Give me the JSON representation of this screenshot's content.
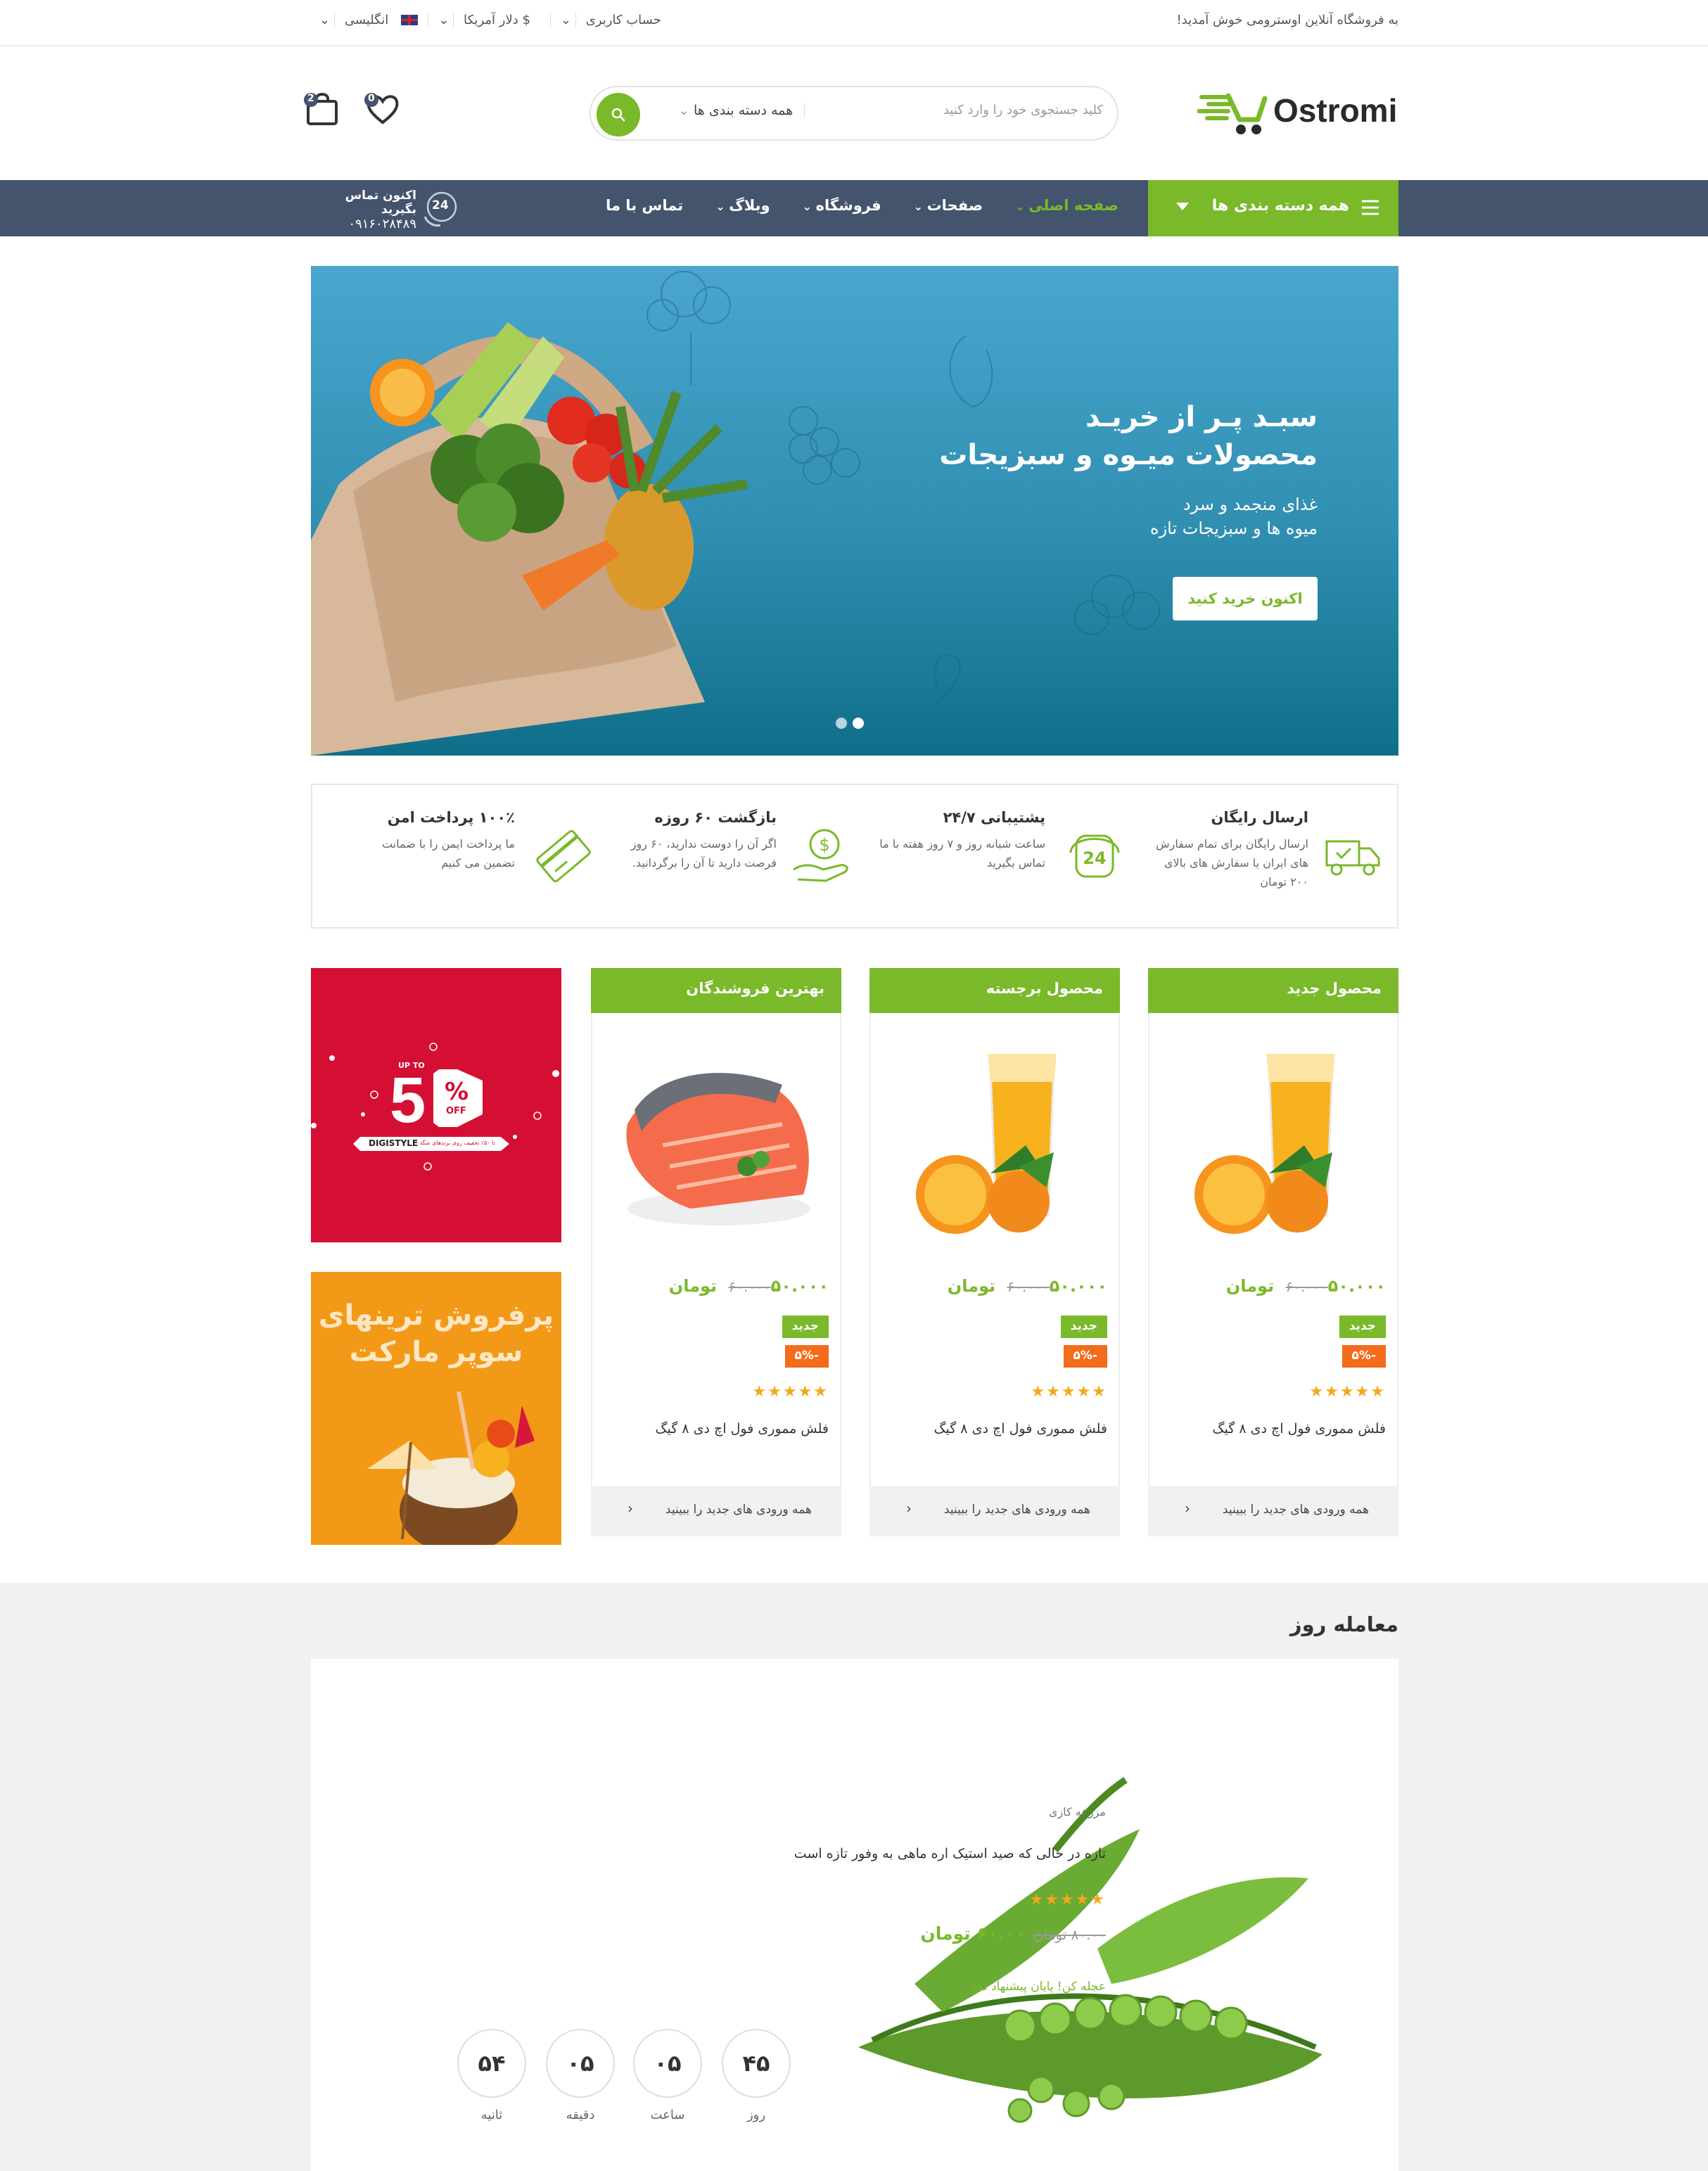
{
  "topbar": {
    "welcome": "به فروشگاه آنلاین اوسترومی خوش آمدید!",
    "account": "حساب کاربری",
    "currency": "$ دلار آمریکا",
    "language": "انگلیسی"
  },
  "header": {
    "logo": "Ostromi",
    "search_placeholder": "کلید جستجوی خود را وارد کنید",
    "search_category": "همه دسته بندی ها",
    "wishlist_count": "0",
    "cart_count": "2"
  },
  "nav": {
    "categories_label": "همه دسته بندی ها",
    "items": [
      "صفحه اصلی",
      "صفحات",
      "فروشگاه",
      "وبلاگ",
      "تماس با ما"
    ],
    "contact_title": "اکنون تماس بگیرید",
    "contact_phone": "۰۹۱۶۰۲۸۴۸۹",
    "contact_badge": "24"
  },
  "slider": {
    "title_line1": "سبـد پـر از خریـد",
    "title_line2": "محصولات میـوه و سبزیجات",
    "subtitle_line1": "غذای منجمد و سرد",
    "subtitle_line2": "میوه ها و سبزیجات تازه",
    "button": "اکنون خرید کنید"
  },
  "features": [
    {
      "title": "ارسال رایگان",
      "desc": "ارسال رایگان برای تمام سفارش های ایران یا سفارش های بالای ۲۰۰ تومان"
    },
    {
      "title": "پشتیبانی ۲۴/۷",
      "desc": "ساعت شبانه روز و ۷ روز هفته با ما تماس بگیرید"
    },
    {
      "title": "بازگشت ۶۰ روزه",
      "desc": "اگر آن را دوست ندارید، ۶۰ روز فرصت دارید تا آن را برگردانید."
    },
    {
      "title": "۱۰۰٪ پرداخت امن",
      "desc": "ما پرداخت ایمن را با ضمانت تضمین می کنیم"
    }
  ],
  "product_columns": [
    {
      "header": "محصول جدید",
      "price": "۵۰.۰۰۰ تومان",
      "old_price": "۶۰.۰۰۰",
      "badge_new": "جدید",
      "badge_sale": "-۵%",
      "stars": "★★★★★",
      "name": "فلش مموری فول اچ دی ۸ گیگ",
      "footer": "همه ورودی های جدید را ببینید"
    },
    {
      "header": "محصول برجسته",
      "price": "۵۰.۰۰۰ تومان",
      "old_price": "۶۰.۰۰۰",
      "badge_new": "جدید",
      "badge_sale": "-۵%",
      "stars": "★★★★★",
      "name": "فلش مموری فول اچ دی ۸ گیگ",
      "footer": "همه ورودی های جدید را ببینید"
    },
    {
      "header": "بهترین فروشندگان",
      "price": "۵۰.۰۰۰ تومان",
      "old_price": "۶۰.۰۰۰",
      "badge_new": "جدید",
      "badge_sale": "-۵%",
      "stars": "★★★★★",
      "name": "فلش مموری فول اچ دی ۸ گیگ",
      "footer": "همه ورودی های جدید را ببینید"
    }
  ],
  "banners": {
    "promo1_up_to": "UP TO",
    "promo1_value": "5",
    "promo1_off": "OFF",
    "promo1_brand": "DIGISTYLE",
    "promo1_tag": "تا ۵۰٪ تخفیف روی برندهای شگفت‌انگیز",
    "promo2_line1": "پرفروش ترینهای",
    "promo2_line2": "سوپر مارکت"
  },
  "deal": {
    "title": "معامله روز",
    "category": "مزرعه کازی",
    "description": "تازه در حالی که صید استیک اره ماهی به وفور تازه است",
    "stars": "★★★★★",
    "old_price": "۸۰.۰۰ تومان",
    "price": "۶۰.۰۰ تومان",
    "hurry": "عجله کن! پایان پیشنهاد در:",
    "countdown": [
      {
        "value": "۴۵",
        "label": "روز"
      },
      {
        "value": "۰۵",
        "label": "ساعت"
      },
      {
        "value": "۰۵",
        "label": "دقیقه"
      },
      {
        "value": "۵۴",
        "label": "ثانیه"
      }
    ]
  },
  "colors": {
    "accent": "#7ab929",
    "nav": "#44546c",
    "sale": "#f26c1c",
    "star": "#f6a71b"
  }
}
